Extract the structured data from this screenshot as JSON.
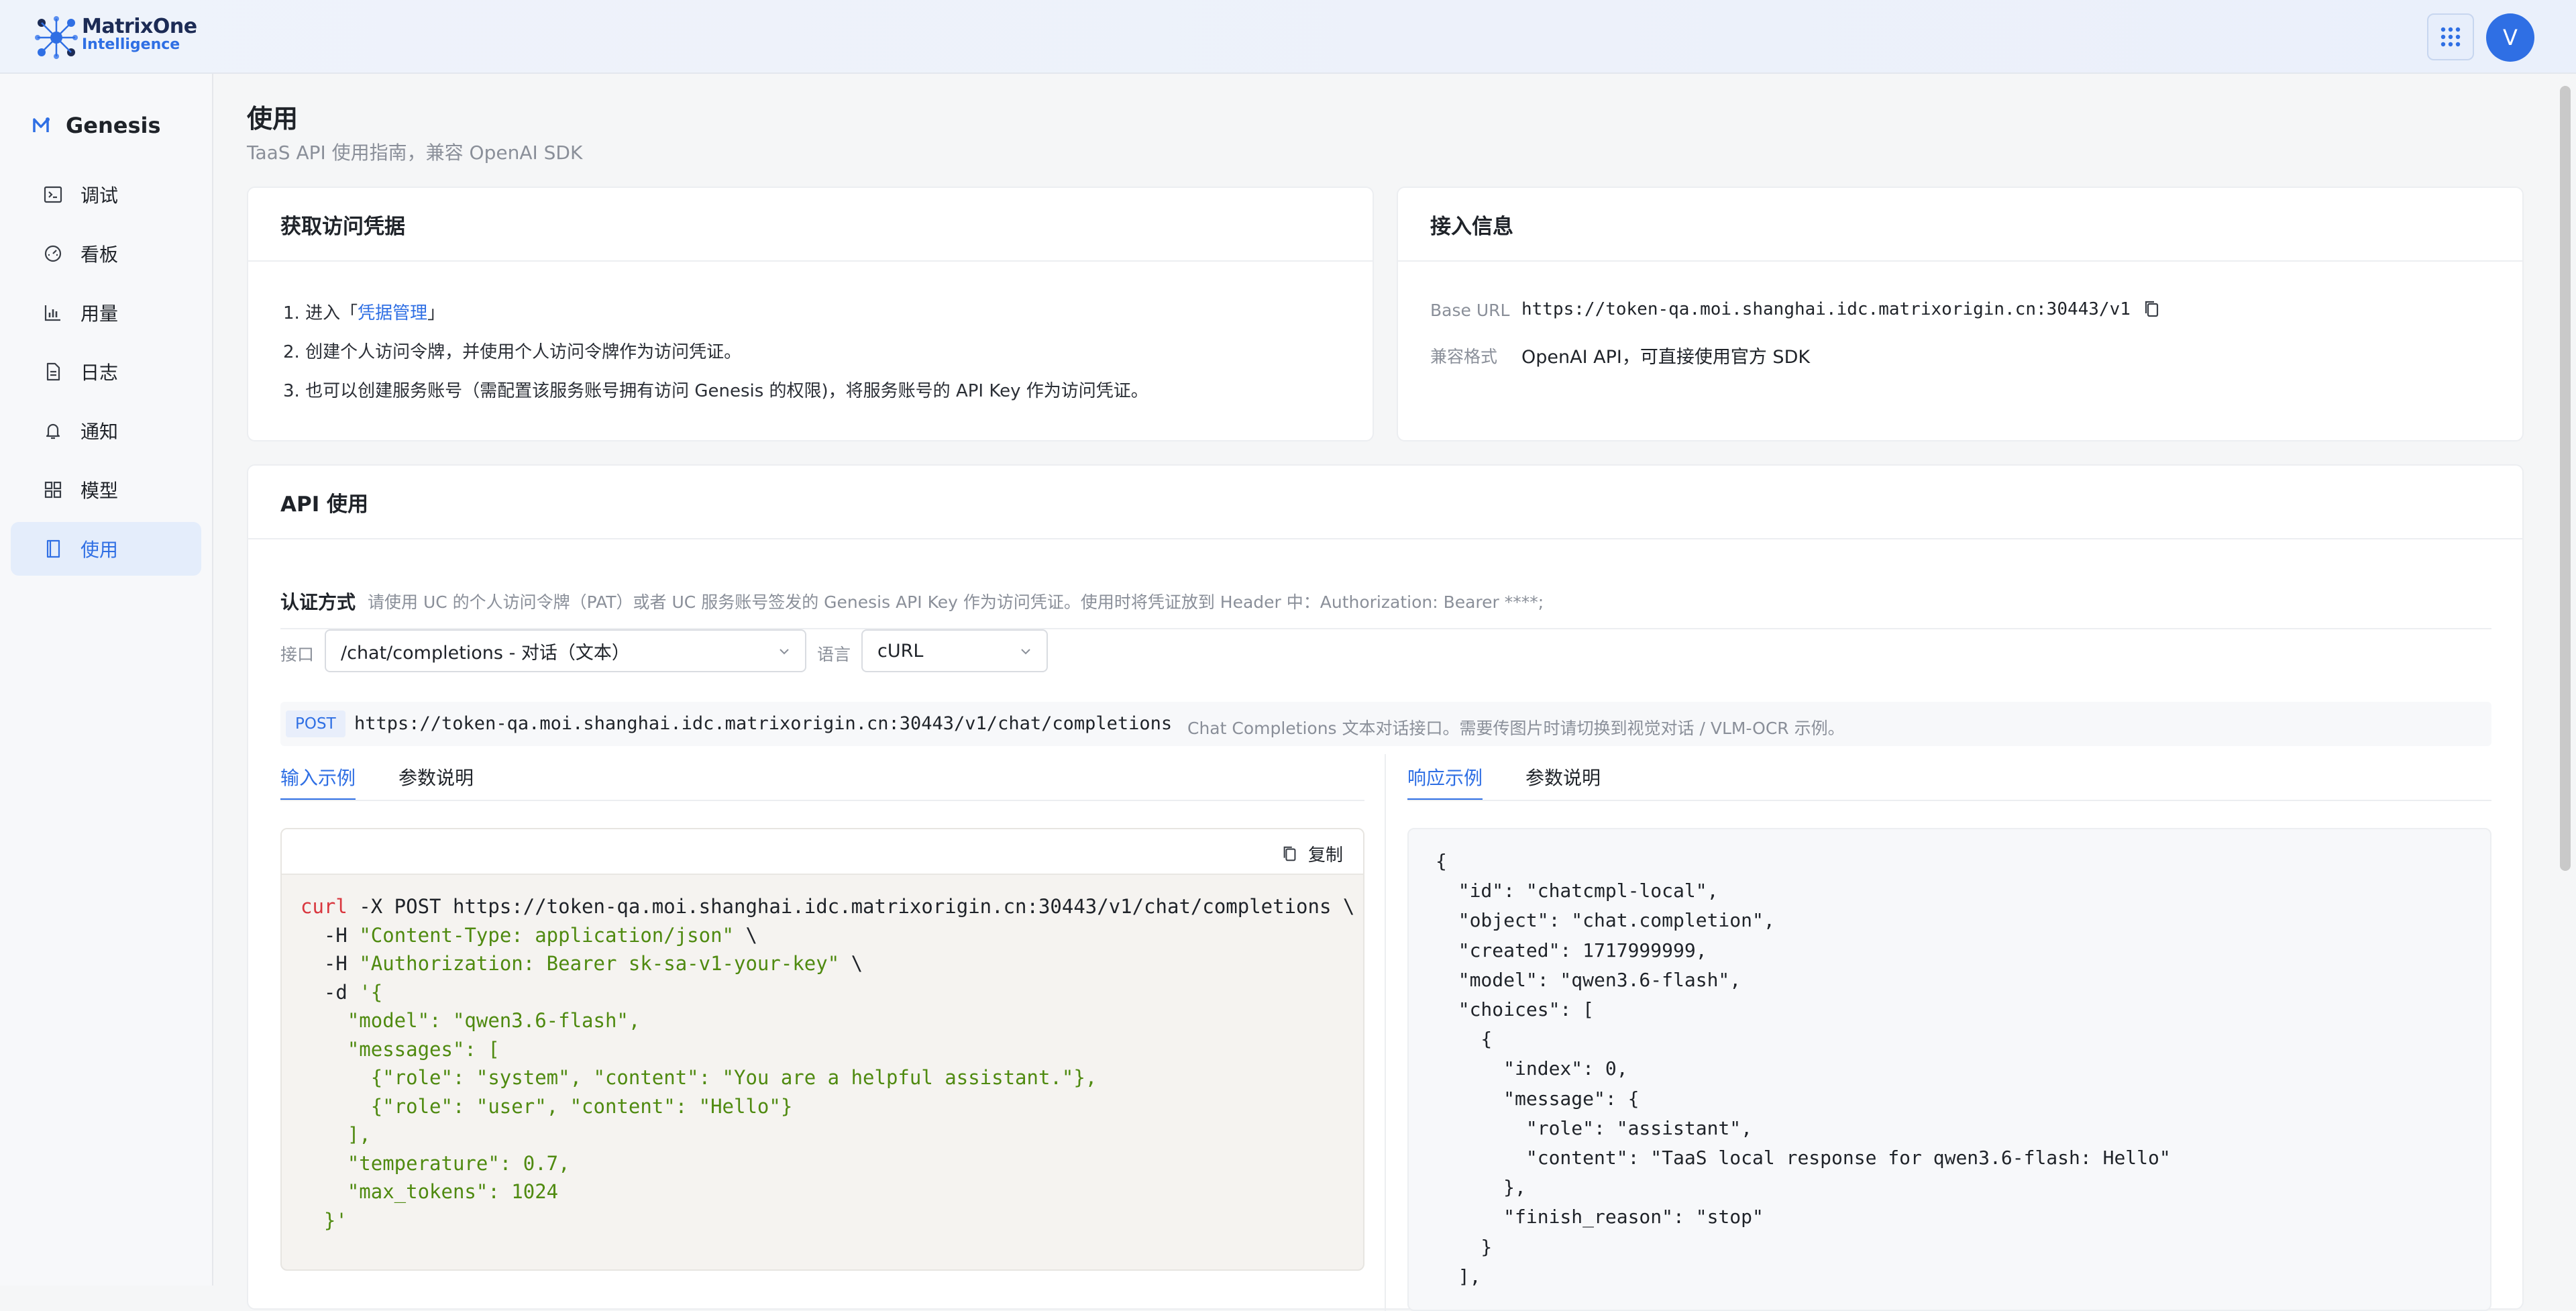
{
  "brand": {
    "line1": "MatrixOne",
    "line2": "Intelligence"
  },
  "user": {
    "avatar_initial": "V"
  },
  "sidebar": {
    "title": "Genesis",
    "items": [
      {
        "label": "调试",
        "icon": "terminal-icon"
      },
      {
        "label": "看板",
        "icon": "dashboard-icon"
      },
      {
        "label": "用量",
        "icon": "bar-chart-icon"
      },
      {
        "label": "日志",
        "icon": "document-icon"
      },
      {
        "label": "通知",
        "icon": "bell-icon"
      },
      {
        "label": "模型",
        "icon": "grid-icon"
      },
      {
        "label": "使用",
        "icon": "book-icon"
      }
    ],
    "active_index": 6
  },
  "page": {
    "title": "使用",
    "subtitle": "TaaS API 使用指南，兼容 OpenAI SDK"
  },
  "credentials": {
    "title": "获取访问凭据",
    "step1_prefix": "1. 进入「",
    "step1_link": "凭据管理",
    "step1_suffix": "」",
    "step2": "2. 创建个人访问令牌，并使用个人访问令牌作为访问凭证。",
    "step3": "3. 也可以创建服务账号（需配置该服务账号拥有访问 Genesis 的权限)，将服务账号的 API Key 作为访问凭证。"
  },
  "access_info": {
    "title": "接入信息",
    "base_url_label": "Base URL",
    "base_url": "https://token-qa.moi.shanghai.idc.matrixorigin.cn:30443/v1",
    "compat_label": "兼容格式",
    "compat_value": "OpenAI API，可直接使用官方 SDK"
  },
  "api_usage": {
    "title": "API 使用",
    "auth_label": "认证方式",
    "auth_desc": "请使用 UC 的个人访问令牌（PAT）或者 UC 服务账号签发的 Genesis API Key 作为访问凭证。使用时将凭证放到 Header 中：Authorization: Bearer ****;",
    "endpoint_label": "接口",
    "endpoint_value": "/chat/completions - 对话（文本）",
    "lang_label": "语言",
    "lang_value": "cURL",
    "method": "POST",
    "endpoint_url": "https://token-qa.moi.shanghai.idc.matrixorigin.cn:30443/v1/chat/completions",
    "endpoint_note": "Chat Completions 文本对话接口。需要传图片时请切换到视觉对话 / VLM-OCR 示例。",
    "input_tabs": [
      "输入示例",
      "参数说明"
    ],
    "output_tabs": [
      "响应示例",
      "参数说明"
    ],
    "copy_label": "复制"
  },
  "request_lines": [
    [
      {
        "t": "curl",
        "c": "red"
      },
      {
        "t": " -X POST https://token-qa.moi.shanghai.idc.matrixorigin.cn:30443/v1/chat/completions \\",
        "c": "dark"
      }
    ],
    [
      {
        "t": "  -H ",
        "c": "dark"
      },
      {
        "t": "\"Content-Type: application/json\"",
        "c": "green"
      },
      {
        "t": " \\",
        "c": "dark"
      }
    ],
    [
      {
        "t": "  -H ",
        "c": "dark"
      },
      {
        "t": "\"Authorization: Bearer sk-sa-v1-your-key\"",
        "c": "green"
      },
      {
        "t": " \\",
        "c": "dark"
      }
    ],
    [
      {
        "t": "  -d ",
        "c": "dark"
      },
      {
        "t": "'{",
        "c": "green"
      }
    ],
    [
      {
        "t": "    \"model\": \"qwen3.6-flash\",",
        "c": "green"
      }
    ],
    [
      {
        "t": "    \"messages\": [",
        "c": "green"
      }
    ],
    [
      {
        "t": "      {\"role\": \"system\", \"content\": \"You are a helpful assistant.\"},",
        "c": "green"
      }
    ],
    [
      {
        "t": "      {\"role\": \"user\", \"content\": \"Hello\"}",
        "c": "green"
      }
    ],
    [
      {
        "t": "    ],",
        "c": "green"
      }
    ],
    [
      {
        "t": "    \"temperature\": 0.7,",
        "c": "green"
      }
    ],
    [
      {
        "t": "    \"max_tokens\": 1024",
        "c": "green"
      }
    ],
    [
      {
        "t": "  }'",
        "c": "green"
      }
    ]
  ],
  "response_lines": [
    "{",
    "  \"id\": \"chatcmpl-local\",",
    "  \"object\": \"chat.completion\",",
    "  \"created\": 1717999999,",
    "  \"model\": \"qwen3.6-flash\",",
    "  \"choices\": [",
    "    {",
    "      \"index\": 0,",
    "      \"message\": {",
    "        \"role\": \"assistant\",",
    "        \"content\": \"TaaS local response for qwen3.6-flash: Hello\"",
    "      },",
    "      \"finish_reason\": \"stop\"",
    "    }",
    "  ],"
  ]
}
